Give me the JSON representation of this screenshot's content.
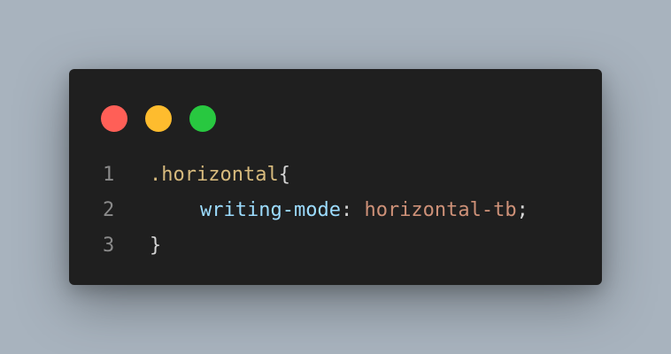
{
  "window": {
    "controls": [
      {
        "name": "close",
        "color": "#ff5f57"
      },
      {
        "name": "minimize",
        "color": "#febc2e"
      },
      {
        "name": "maximize",
        "color": "#28c840"
      }
    ]
  },
  "code": {
    "lines": [
      {
        "number": "1",
        "tokens": [
          {
            "text": ".horizontal",
            "color": "#d7ba7d"
          },
          {
            "text": "{",
            "color": "#d4d4d4"
          }
        ]
      },
      {
        "number": "2",
        "indent": true,
        "tokens": [
          {
            "text": "writing-mode",
            "color": "#9cdcfe"
          },
          {
            "text": ": ",
            "color": "#d4d4d4"
          },
          {
            "text": "horizontal-tb",
            "color": "#ce9178"
          },
          {
            "text": ";",
            "color": "#d4d4d4"
          }
        ]
      },
      {
        "number": "3",
        "tokens": [
          {
            "text": "}",
            "color": "#d4d4d4"
          }
        ]
      }
    ]
  }
}
